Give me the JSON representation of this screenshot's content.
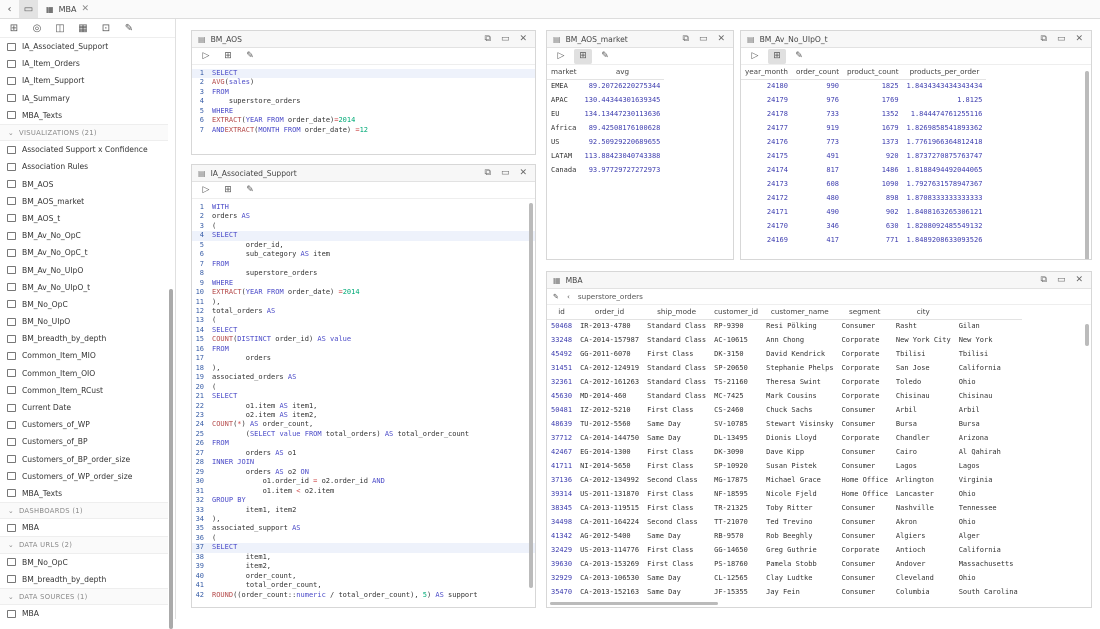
{
  "top": {
    "tab_label": "MBA",
    "icons": [
      "back-icon",
      "folder-icon"
    ]
  },
  "sidebar": {
    "items_top": [
      "IA_Associated_Support",
      "IA_Item_Orders",
      "IA_Item_Support",
      "IA_Summary",
      "MBA_Texts"
    ],
    "sec_vis": "VISUALIZATIONS (21)",
    "visualizations": [
      "Associated Support x Confidence",
      "Association Rules",
      "BM_AOS",
      "BM_AOS_market",
      "BM_AOS_t",
      "BM_Av_No_OpC",
      "BM_Av_No_OpC_t",
      "BM_Av_No_UIpO",
      "BM_Av_No_UIpO_t",
      "BM_No_OpC",
      "BM_No_UIpO",
      "BM_breadth_by_depth",
      "Common_Item_MIO",
      "Common_Item_OIO",
      "Common_Item_RCust",
      "Current Date",
      "Customers_of_WP",
      "Customers_of_BP",
      "Customers_of_BP_order_size",
      "Customers_of_WP_order_size",
      "MBA_Texts"
    ],
    "sec_dash": "DASHBOARDS (1)",
    "dashboards": [
      "MBA"
    ],
    "sec_urls": "DATA URLS (2)",
    "urls": [
      "BM_No_OpC",
      "BM_breadth_by_depth"
    ],
    "sec_src": "DATA SOURCES (1)",
    "sources": [
      "MBA"
    ]
  },
  "p_aos": {
    "title": "BM_AOS"
  },
  "p_ias": {
    "title": "IA_Associated_Support"
  },
  "p_market": {
    "title": "BM_AOS_market",
    "cols": [
      "market",
      "avg"
    ],
    "rows": [
      [
        "EMEA",
        "89.20726220275344"
      ],
      [
        "APAC",
        "130.44344301639345"
      ],
      [
        "EU",
        "134.13447230113636"
      ],
      [
        "Africa",
        "89.42508176100628"
      ],
      [
        "US",
        "92.50929220689655"
      ],
      [
        "LATAM",
        "113.88423040743388"
      ],
      [
        "Canada",
        "93.97729727272973"
      ]
    ]
  },
  "p_avno": {
    "title": "BM_Av_No_UIpO_t",
    "cols": [
      "year_month",
      "order_count",
      "product_count",
      "products_per_order"
    ],
    "rows": [
      [
        "24180",
        "990",
        "1825",
        "1.8434343434343434"
      ],
      [
        "24179",
        "976",
        "1769",
        "1.8125"
      ],
      [
        "24178",
        "733",
        "1352",
        "1.844474761255116"
      ],
      [
        "24177",
        "919",
        "1679",
        "1.8269858541893362"
      ],
      [
        "24176",
        "773",
        "1373",
        "1.7761966364812418"
      ],
      [
        "24175",
        "491",
        "920",
        "1.8737270875763747"
      ],
      [
        "24174",
        "817",
        "1486",
        "1.8188494492044065"
      ],
      [
        "24173",
        "608",
        "1090",
        "1.7927631578947367"
      ],
      [
        "24172",
        "480",
        "898",
        "1.8708333333333333"
      ],
      [
        "24171",
        "490",
        "902",
        "1.8408163265306121"
      ],
      [
        "24170",
        "346",
        "630",
        "1.8208092485549132"
      ],
      [
        "24169",
        "417",
        "771",
        "1.8489208633093526"
      ]
    ]
  },
  "p_mba": {
    "title": "MBA",
    "crumb": "superstore_orders",
    "cols": [
      "id",
      "order_id",
      "ship_mode",
      "customer_id",
      "customer_name",
      "segment",
      "city",
      ""
    ],
    "rows": [
      [
        "50468",
        "IR-2013-4780",
        "Standard Class",
        "RP-9390",
        "Resi Pölking",
        "Consumer",
        "Rasht",
        "Gilan"
      ],
      [
        "33248",
        "CA-2014-157987",
        "Standard Class",
        "AC-10615",
        "Ann Chong",
        "Corporate",
        "New York City",
        "New York"
      ],
      [
        "45492",
        "GG-2011-6070",
        "First Class",
        "DK-3150",
        "David Kendrick",
        "Corporate",
        "Tbilisi",
        "Tbilisi"
      ],
      [
        "31451",
        "CA-2012-124919",
        "Standard Class",
        "SP-20650",
        "Stephanie Phelps",
        "Corporate",
        "San Jose",
        "California"
      ],
      [
        "32361",
        "CA-2012-161263",
        "Standard Class",
        "TS-21160",
        "Theresa Swint",
        "Corporate",
        "Toledo",
        "Ohio"
      ],
      [
        "45630",
        "MD-2014-460",
        "Standard Class",
        "MC-7425",
        "Mark Cousins",
        "Corporate",
        "Chisinau",
        "Chisinau"
      ],
      [
        "50481",
        "IZ-2012-5210",
        "First Class",
        "CS-2460",
        "Chuck Sachs",
        "Consumer",
        "Arbil",
        "Arbil"
      ],
      [
        "48639",
        "TU-2012-5560",
        "Same Day",
        "SV-10785",
        "Stewart Visinsky",
        "Consumer",
        "Bursa",
        "Bursa"
      ],
      [
        "37712",
        "CA-2014-144750",
        "Same Day",
        "DL-13495",
        "Dionis Lloyd",
        "Corporate",
        "Chandler",
        "Arizona"
      ],
      [
        "42467",
        "EG-2014-1300",
        "First Class",
        "DK-3090",
        "Dave Kipp",
        "Consumer",
        "Cairo",
        "Al Qahirah"
      ],
      [
        "41711",
        "NI-2014-5650",
        "First Class",
        "SP-10920",
        "Susan Pistek",
        "Consumer",
        "Lagos",
        "Lagos"
      ],
      [
        "37136",
        "CA-2012-134992",
        "Second Class",
        "MG-17875",
        "Michael Grace",
        "Home Office",
        "Arlington",
        "Virginia"
      ],
      [
        "39314",
        "US-2011-131870",
        "First Class",
        "NF-18595",
        "Nicole Fjeld",
        "Home Office",
        "Lancaster",
        "Ohio"
      ],
      [
        "38345",
        "CA-2013-119515",
        "First Class",
        "TR-21325",
        "Toby Ritter",
        "Consumer",
        "Nashville",
        "Tennessee"
      ],
      [
        "34498",
        "CA-2011-164224",
        "Second Class",
        "TT-21070",
        "Ted Trevino",
        "Consumer",
        "Akron",
        "Ohio"
      ],
      [
        "41342",
        "AG-2012-5400",
        "Same Day",
        "RB-9570",
        "Rob Beeghly",
        "Consumer",
        "Algiers",
        "Alger"
      ],
      [
        "32429",
        "US-2013-114776",
        "First Class",
        "GG-14650",
        "Greg Guthrie",
        "Corporate",
        "Antioch",
        "California"
      ],
      [
        "39630",
        "CA-2013-153269",
        "First Class",
        "PS-18760",
        "Pamela Stobb",
        "Consumer",
        "Andover",
        "Massachusetts"
      ],
      [
        "32929",
        "CA-2013-106530",
        "Same Day",
        "CL-12565",
        "Clay Ludtke",
        "Consumer",
        "Cleveland",
        "Ohio"
      ],
      [
        "35470",
        "CA-2013-152163",
        "Same Day",
        "JF-15355",
        "Jay Fein",
        "Consumer",
        "Columbia",
        "South Carolina"
      ]
    ]
  }
}
